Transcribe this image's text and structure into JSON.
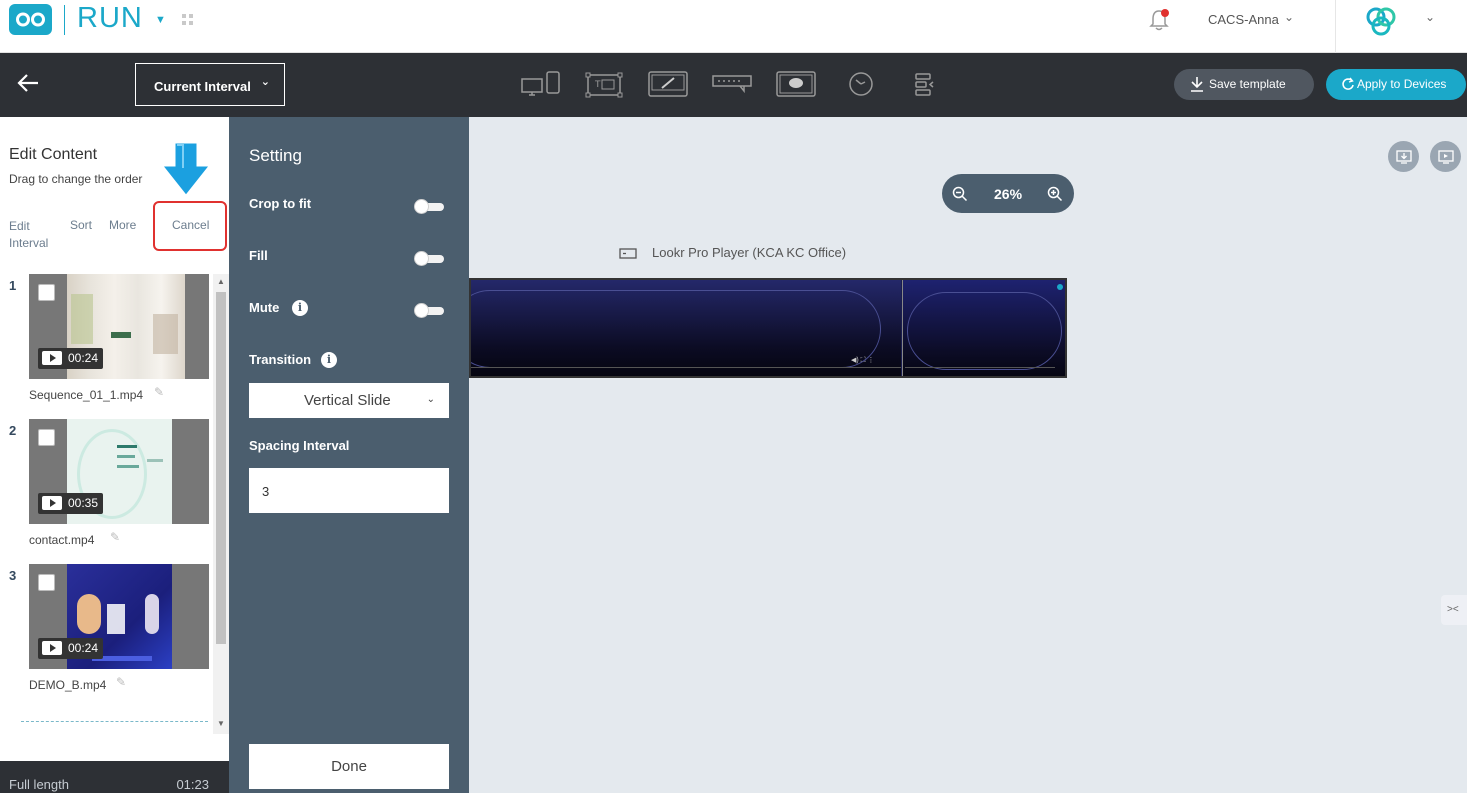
{
  "app": {
    "title": "RUN"
  },
  "user": {
    "name": "CACS-Anna"
  },
  "toolbar": {
    "interval_label": "Current Interval",
    "save_label": "Save template",
    "apply_label": "Apply to Devices",
    "icons": [
      "multi-screen-icon",
      "text-grid-icon",
      "edit-screen-icon",
      "ticker-icon",
      "message-screen-icon",
      "clock-icon",
      "align-icon"
    ]
  },
  "left": {
    "title": "Edit Content",
    "subtitle": "Drag to change the order",
    "actions": {
      "edit_interval": "Edit\nInterval",
      "sort": "Sort",
      "more": "More",
      "cancel": "Cancel"
    },
    "items": [
      {
        "num": "1",
        "duration": "00:24",
        "name": "Sequence_01_1.mp4"
      },
      {
        "num": "2",
        "duration": "00:35",
        "name": "contact.mp4"
      },
      {
        "num": "3",
        "duration": "00:24",
        "name": "DEMO_B.mp4"
      }
    ],
    "footer": {
      "label": "Full length",
      "value": "01:23"
    }
  },
  "settings": {
    "title": "Setting",
    "crop": "Crop to fit",
    "fill": "Fill",
    "mute": "Mute",
    "transition": "Transition",
    "transition_value": "Vertical Slide",
    "spacing": "Spacing Interval",
    "spacing_value": "3",
    "done": "Done",
    "toggles": {
      "crop": false,
      "fill": false,
      "mute": false
    }
  },
  "canvas": {
    "zoom": "26%",
    "player_name": "Lookr Pro Player (KCA KC Office)"
  },
  "colors": {
    "accent": "#1ba8c9",
    "toolbar": "#2d3035",
    "settings_bg": "#4b5e6e",
    "highlight": "#e0312f"
  }
}
